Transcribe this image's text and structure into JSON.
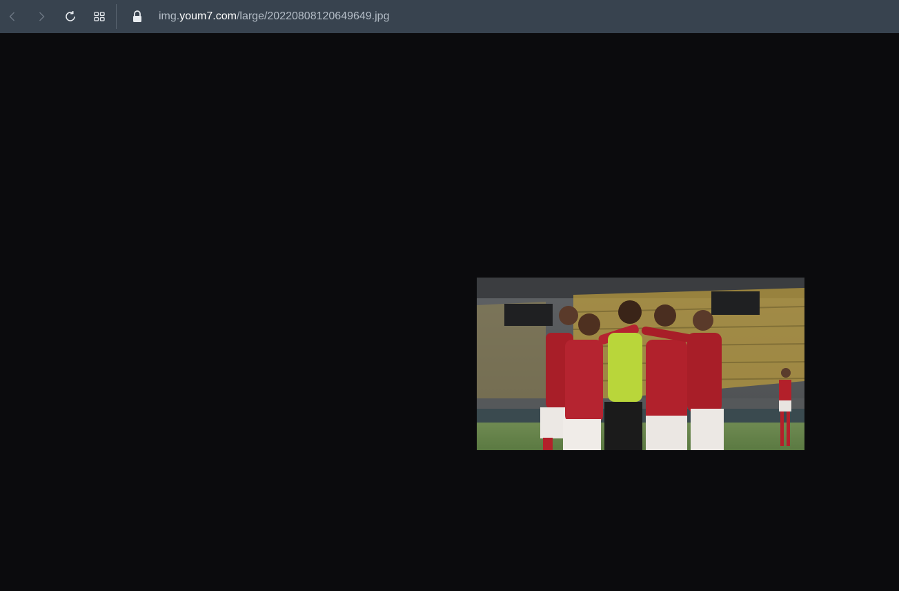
{
  "browser": {
    "icons": {
      "back": "chevron-left-icon",
      "forward": "chevron-right-icon",
      "reload": "reload-icon",
      "tabs": "grid-icon",
      "lock": "lock-icon"
    },
    "url": {
      "prefix": "img.",
      "host": "youm7.com",
      "path": "/large/20220808120649649.jpg"
    }
  },
  "colors": {
    "toolbar_bg": "#38434f",
    "viewport_bg": "#0b0b0d",
    "jersey_red": "#b3202a",
    "goalkeeper_kit": "#b9d63a"
  },
  "content": {
    "image_subject": "photo"
  }
}
